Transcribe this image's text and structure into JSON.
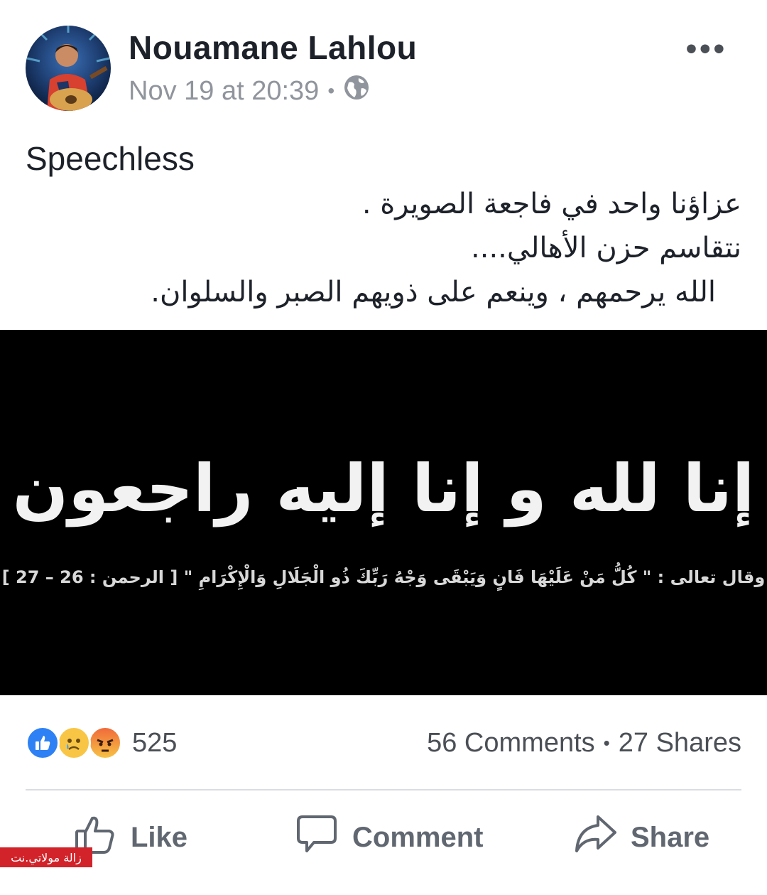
{
  "post": {
    "author": "Nouamane Lahlou",
    "timestamp": "Nov 19 at 20:39",
    "meta_separator": "•",
    "privacy_icon": "globe-icon",
    "more_label": "•••",
    "text_en": "Speechless",
    "text_ar": [
      "عزاؤنا واحد في فاجعة الصويرة .",
      "نتقاسم حزن الأهالي....",
      "الله يرحمهم ، وينعم على ذويهم  الصبر والسلوان."
    ],
    "image": {
      "headline": "إنا لله و إنا إليه راجعون",
      "verse": "وقال تعالى : \" كُلُّ مَنْ عَلَيْهَا فَانٍ وَيَبْقَى وَجْهُ رَبِّكَ ذُو الْجَلَالِ وَالْإِكْرَامِ \" [ الرحمن : 26 – 27 ]",
      "background": "#000000"
    }
  },
  "engagement": {
    "reaction_icons": [
      "like-reaction-icon",
      "sad-reaction-icon",
      "angry-reaction-icon"
    ],
    "reaction_count": "525",
    "comments": "56 Comments",
    "separator": "•",
    "shares": "27 Shares"
  },
  "actions": {
    "like": "Like",
    "comment": "Comment",
    "share": "Share"
  },
  "watermark": "زالة مولاتي.نت",
  "colors": {
    "like_blue": "#2e81f4",
    "text_primary": "#1d2129",
    "text_secondary": "#90949c",
    "action_gray": "#606770",
    "watermark_red": "#d2232a"
  }
}
